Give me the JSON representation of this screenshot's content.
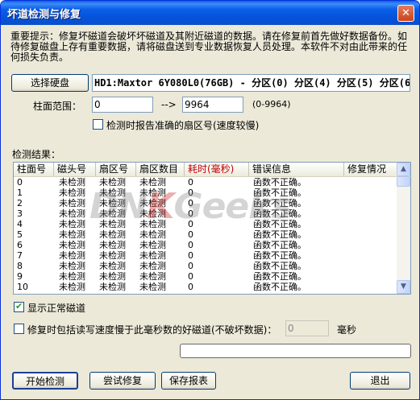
{
  "window": {
    "title": "坏道检测与修复",
    "close_glyph": "✕"
  },
  "notice": "重要提示：修复坏磁道会破坏坏磁道及其附近磁道的数据。请在修复前首先做好数据备份。如待修复磁盘上存有重要数据，请将磁盘送到专业数据恢复人员处理。本软件不对由此带来的任何损失负责。",
  "drive": {
    "button_label": "选择硬盘",
    "value": "HD1:Maxtor 6Y080L0(76GB) - 分区(0) 分区(4) 分区(5) 分区(6"
  },
  "cylinder": {
    "label": "柱面范围：",
    "from": "0",
    "arrow": "-->",
    "to": "9964",
    "range": "(0-9964)"
  },
  "report_sector_option": {
    "label": "检测时报告准确的扇区号(速度较慢)",
    "checked": false
  },
  "results": {
    "label": "检测结果：",
    "columns": [
      "柱面号",
      "磁头号",
      "扇区号",
      "扇区数目",
      "耗时(毫秒)",
      "错误信息",
      "修复情况"
    ],
    "rows": [
      [
        "0",
        "未检测",
        "未检测",
        "未检测",
        "0",
        "函数不正确。",
        ""
      ],
      [
        "1",
        "未检测",
        "未检测",
        "未检测",
        "0",
        "函数不正确。",
        ""
      ],
      [
        "2",
        "未检测",
        "未检测",
        "未检测",
        "0",
        "函数不正确。",
        ""
      ],
      [
        "3",
        "未检测",
        "未检测",
        "未检测",
        "0",
        "函数不正确。",
        ""
      ],
      [
        "4",
        "未检测",
        "未检测",
        "未检测",
        "0",
        "函数不正确。",
        ""
      ],
      [
        "5",
        "未检测",
        "未检测",
        "未检测",
        "0",
        "函数不正确。",
        ""
      ],
      [
        "6",
        "未检测",
        "未检测",
        "未检测",
        "0",
        "函数不正确。",
        ""
      ],
      [
        "7",
        "未检测",
        "未检测",
        "未检测",
        "0",
        "函数不正确。",
        ""
      ],
      [
        "8",
        "未检测",
        "未检测",
        "未检测",
        "0",
        "函数不正确。",
        ""
      ],
      [
        "9",
        "未检测",
        "未检测",
        "未检测",
        "0",
        "函数不正确。",
        ""
      ],
      [
        "10",
        "未检测",
        "未检测",
        "未检测",
        "0",
        "函数不正确。",
        ""
      ]
    ]
  },
  "show_normal_tracks": {
    "label": "显示正常磁道",
    "checked": true
  },
  "slow_read_option": {
    "label": "修复时包括读写速度慢于此毫秒数的好磁道(不破坏数据)：",
    "value": "0",
    "unit": "毫秒",
    "checked": false
  },
  "progress": {
    "value": 0
  },
  "buttons": {
    "start": "开始检测",
    "try_repair": "尝试修复",
    "save_report": "保存报表",
    "exit": "退出"
  },
  "watermark": {
    "text_a": "DN",
    "text_k": "K",
    "text_b": "Geeks"
  },
  "colors": {
    "titlebar": "#0a5fe8",
    "dialog_bg": "#ece9d8",
    "header_highlight": "#c00000",
    "checkmark": "#21a121"
  }
}
